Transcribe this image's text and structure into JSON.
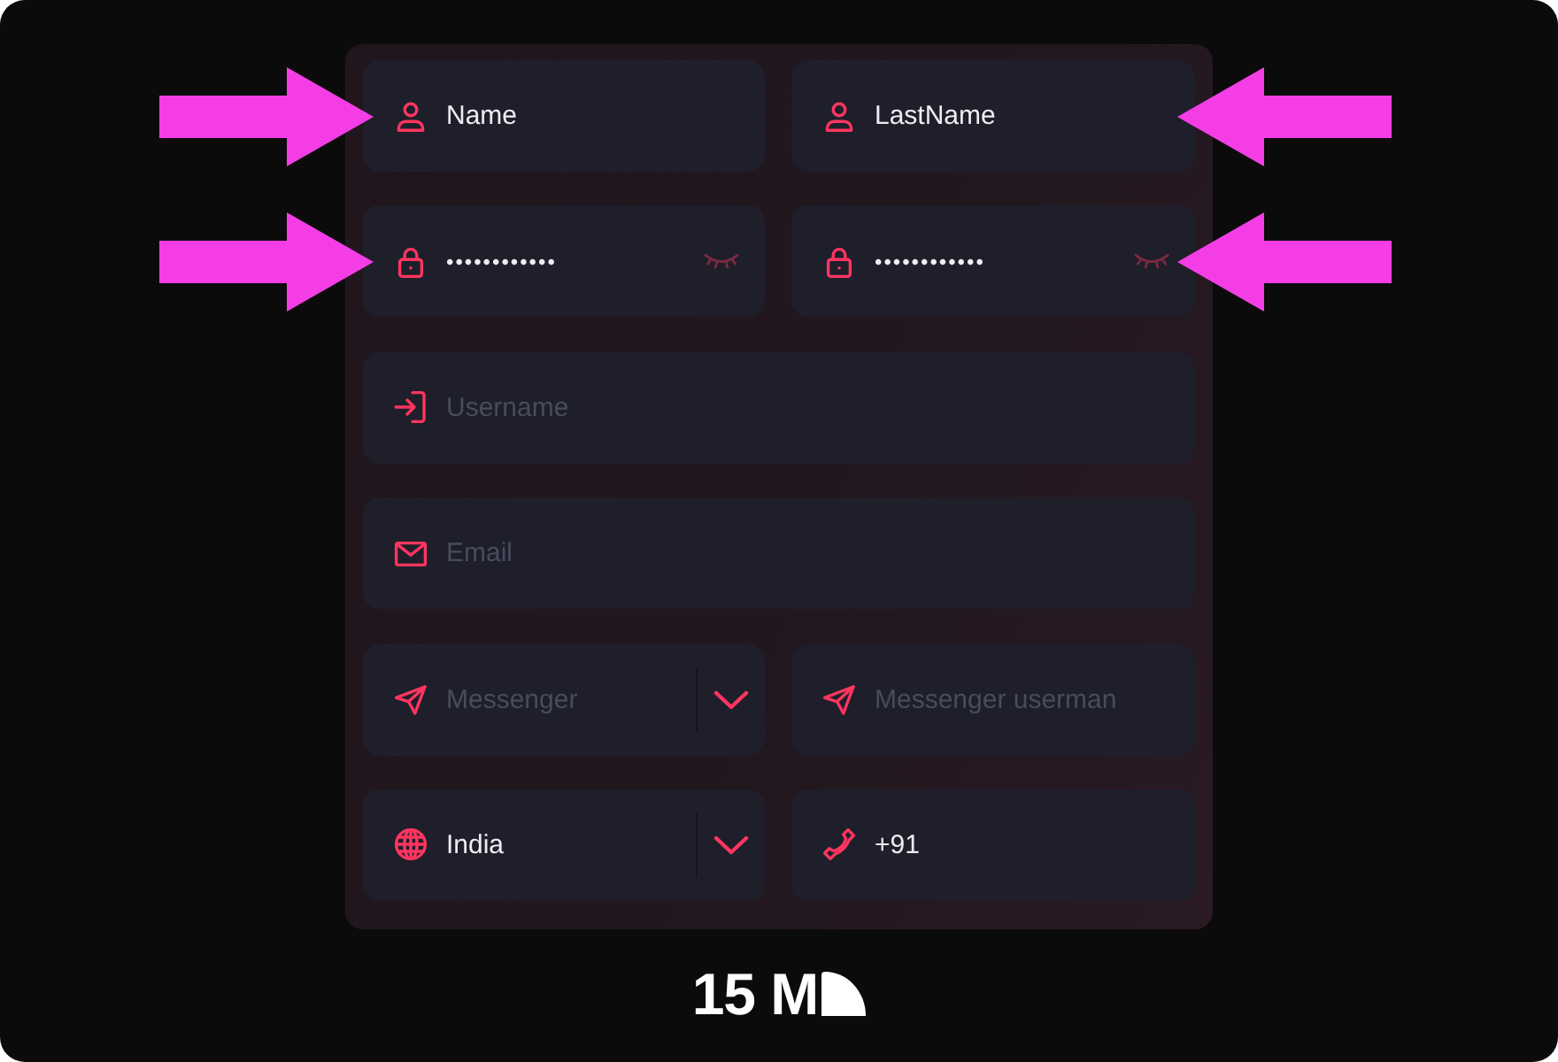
{
  "form": {
    "rows": [
      {
        "fields": [
          {
            "kind": "name",
            "value": "Name",
            "highlighted": true
          },
          {
            "kind": "name",
            "value": "LastName",
            "highlighted": true
          }
        ]
      },
      {
        "fields": [
          {
            "kind": "password",
            "value": "••••••••••••",
            "shown": false,
            "highlighted": true
          },
          {
            "kind": "password",
            "value": "••••••••••••",
            "shown": false,
            "highlighted": true
          }
        ]
      },
      {
        "fields": [
          {
            "kind": "username",
            "placeholder": "Username",
            "highlighted": false
          }
        ]
      },
      {
        "fields": [
          {
            "kind": "email",
            "placeholder": "Email",
            "highlighted": false
          }
        ]
      },
      {
        "fields": [
          {
            "kind": "messenger",
            "placeholder": "Messenger",
            "highlighted": false
          },
          {
            "kind": "handle",
            "placeholder": "Messenger userman",
            "highlighted": false
          }
        ]
      },
      {
        "fields": [
          {
            "kind": "country",
            "value": "India",
            "highlighted": false
          },
          {
            "kind": "phone",
            "value": "+91",
            "highlighted": false
          }
        ]
      }
    ]
  },
  "logo": {
    "text": "15 M"
  }
}
